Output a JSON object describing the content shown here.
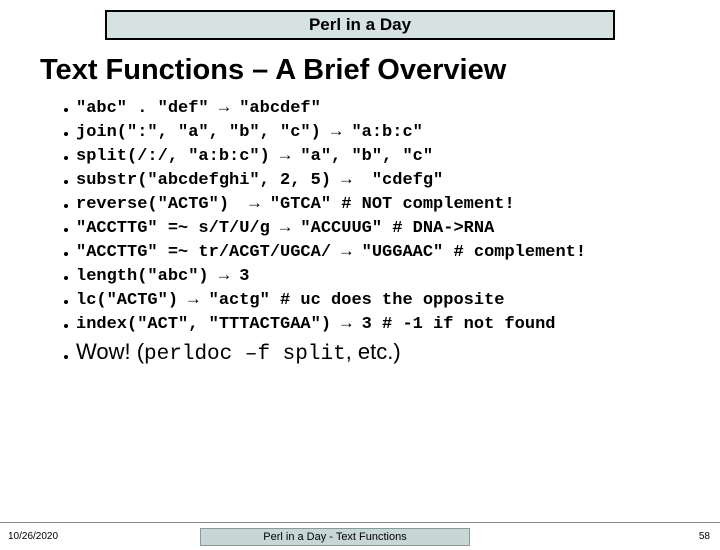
{
  "banner": "Perl in a Day",
  "headline": "Text Functions – A Brief Overview",
  "bullets": [
    "\"abc\" . \"def\" → \"abcdef\"",
    "join(\":\", \"a\", \"b\", \"c\") → \"a:b:c\"",
    "split(/:/, \"a:b:c\") → \"a\", \"b\", \"c\"",
    "substr(\"abcdefghi\", 2, 5) →  \"cdefg\"",
    "reverse(\"ACTG\")  → \"GTCA\" # NOT complement!",
    "\"ACCTTG\" =~ s/T/U/g → \"ACCUUG\" # DNA->RNA",
    "\"ACCTTG\" =~ tr/ACGT/UGCA/ → \"UGGAAC\" # complement!",
    "length(\"abc\") → 3",
    "lc(\"ACTG\") → \"actg\" # uc does the opposite",
    "index(\"ACT\", \"TTTACTGAA\") → 3 # -1 if not found"
  ],
  "wow_prefix": "Wow! (",
  "wow_mono": "perldoc –f split",
  "wow_suffix": ", etc.)",
  "footer": {
    "date": "10/26/2020",
    "center": "Perl in a Day - Text Functions",
    "page": "58"
  }
}
